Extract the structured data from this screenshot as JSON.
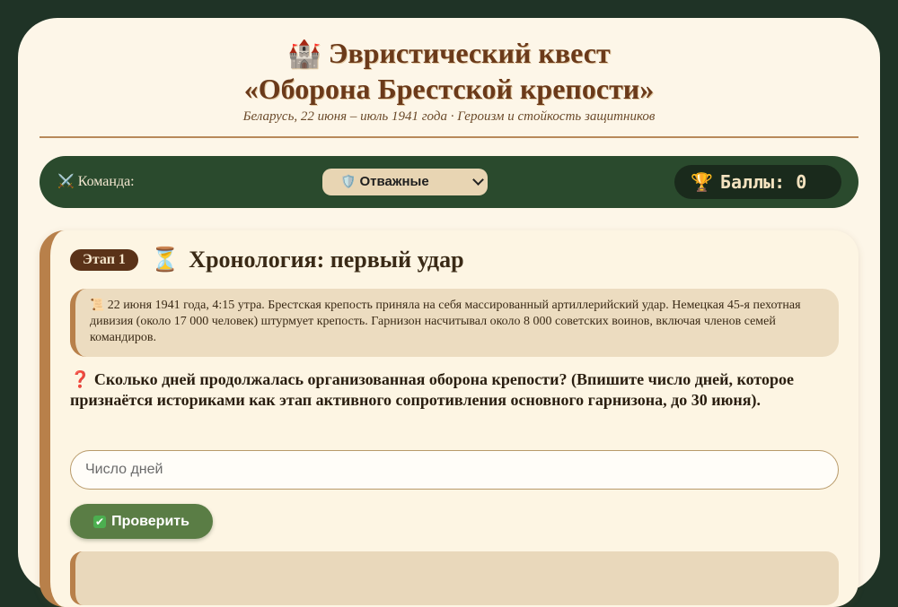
{
  "header": {
    "icon": "castle-icon",
    "title_line1": "Эвристический квест",
    "title_line2": "«Оборона Брестской крепости»",
    "subtitle": "Беларусь, 22 июня – июль 1941 года · Героизм и стойкость защитников"
  },
  "teambar": {
    "team_label": "Команда:",
    "team_icon": "crossed-swords-icon",
    "team_selected": "Отважные",
    "team_select_icon": "shield-icon",
    "score_label": "Баллы:",
    "score_value": "0",
    "score_icon": "trophy-icon"
  },
  "stage": {
    "badge": "Этап 1",
    "icon": "hourglass-icon",
    "title": "Хронология: первый удар",
    "info_icon": "scroll-icon",
    "info_text": "22 июня 1941 года, 4:15 утра. Брестская крепость приняла на себя массированный артиллерийский удар. Немецкая 45-я пехотная дивизия (около 17 000 человек) штурмует крепость. Гарнизон насчитывал около 8 000 советских воинов, включая членов семей командиров.",
    "question_icon": "question-icon",
    "question": "Сколько дней продолжалась организованная оборона крепости? (Впишите число дней, которое признаётся историками как этап активного сопротивления основного гарнизона, до 30 июня).",
    "answer_placeholder": "Число дней",
    "answer_value": "",
    "check_button": "Проверить",
    "check_icon": "check-mark-icon"
  },
  "colors": {
    "background": "#1f3326",
    "card": "#fdf6e8",
    "title": "#6b3a1a",
    "teambar": "#2a4a2d",
    "accent_border": "#b8804a",
    "button": "#5a7d45"
  }
}
